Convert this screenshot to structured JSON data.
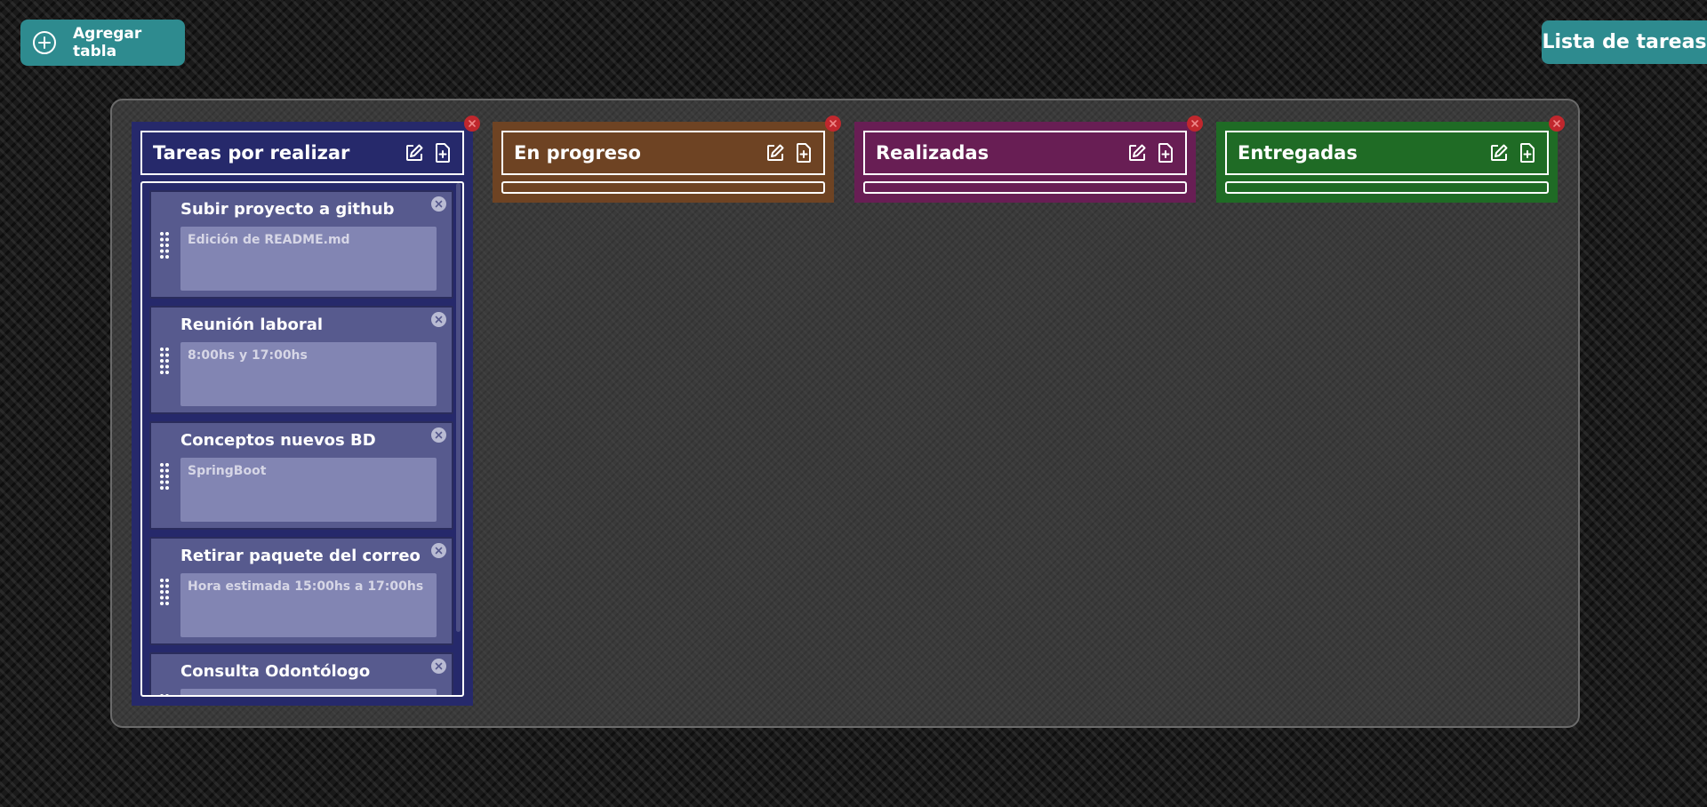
{
  "toolbar": {
    "add_table_label": "Agregar tabla",
    "add_icon": "plus-circle-icon"
  },
  "app": {
    "title": "Lista de tareas"
  },
  "columns": [
    {
      "title": "Tareas por realizar",
      "color": "#26296b",
      "cards": [
        {
          "title": "Subir proyecto a github",
          "description": "Edición de README.md"
        },
        {
          "title": "Reunión laboral",
          "description": "8:00hs y 17:00hs"
        },
        {
          "title": "Conceptos nuevos BD",
          "description": "SpringBoot"
        },
        {
          "title": "Retirar paquete del correo",
          "description": "Hora estimada 15:00hs a 17:00hs"
        },
        {
          "title": "Consulta Odontólogo",
          "description": ""
        }
      ]
    },
    {
      "title": "En progreso",
      "color": "#6e4323",
      "cards": []
    },
    {
      "title": "Realizadas",
      "color": "#681e54",
      "cards": []
    },
    {
      "title": "Entregadas",
      "color": "#1f6b25",
      "cards": []
    }
  ],
  "icons": {
    "edit": "edit-icon",
    "add_card": "file-add-icon",
    "close": "close-icon",
    "drag": "drag-handle-icon"
  }
}
